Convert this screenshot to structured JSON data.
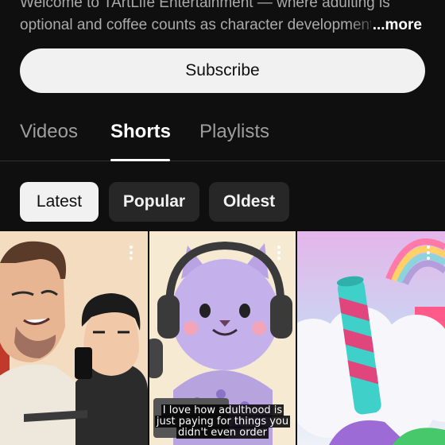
{
  "channel": {
    "description_line1": "Welcome to TArtLife Entertainment — where adulting is",
    "description_line2": "optional and coffee counts as character development",
    "more_label": "...more"
  },
  "subscribe": {
    "label": "Subscribe"
  },
  "tabs": [
    {
      "label": "Videos",
      "active": false
    },
    {
      "label": "Shorts",
      "active": true
    },
    {
      "label": "Playlists",
      "active": false
    }
  ],
  "filters": [
    {
      "label": "Latest",
      "selected": true
    },
    {
      "label": "Popular",
      "selected": false
    },
    {
      "label": "Oldest",
      "selected": false
    }
  ],
  "shorts": [
    {
      "caption": ""
    },
    {
      "caption": "I love how adulthood is just paying for things you didn't even order"
    },
    {
      "caption": ""
    }
  ],
  "colors": {
    "background": "#0f0f0f",
    "chip_bg": "#272727",
    "subscribe_bg": "#f1f1f1"
  }
}
